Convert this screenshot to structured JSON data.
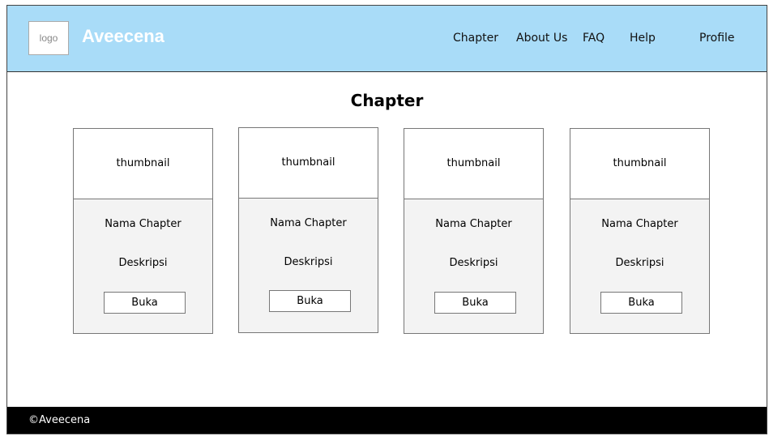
{
  "header": {
    "logo_text": "logo",
    "brand": "Aveecena",
    "nav": [
      {
        "label": "Chapter"
      },
      {
        "label": "About Us"
      },
      {
        "label": "FAQ"
      },
      {
        "label": "Help"
      },
      {
        "label": "Profile"
      }
    ]
  },
  "main": {
    "title": "Chapter",
    "cards": [
      {
        "thumbnail": "thumbnail",
        "name": "Nama Chapter",
        "description": "Deskripsi",
        "button": "Buka"
      },
      {
        "thumbnail": "thumbnail",
        "name": "Nama Chapter",
        "description": "Deskripsi",
        "button": "Buka"
      },
      {
        "thumbnail": "thumbnail",
        "name": "Nama Chapter",
        "description": "Deskripsi",
        "button": "Buka"
      },
      {
        "thumbnail": "thumbnail",
        "name": "Nama Chapter",
        "description": "Deskripsi",
        "button": "Buka"
      }
    ]
  },
  "footer": {
    "copyright": "©Aveecena"
  },
  "colors": {
    "header_bg": "#a9dcf8",
    "brand_text": "#ffffff",
    "card_bg": "#f3f3f3",
    "footer_bg": "#000000"
  }
}
